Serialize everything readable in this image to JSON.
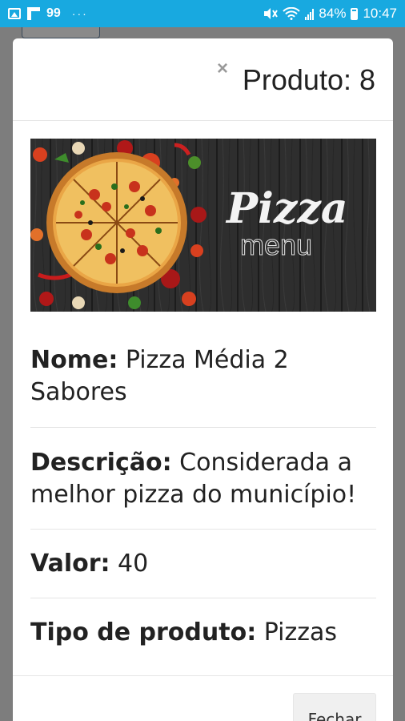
{
  "status_bar": {
    "notification_count": "99",
    "overflow_dots": "···",
    "battery_percent": "84%",
    "time": "10:47"
  },
  "modal": {
    "close_glyph": "×",
    "title": "Produto: 8",
    "banner": {
      "script_text": "Pizza",
      "sub_text": "menu"
    },
    "fields": [
      {
        "label": "Nome:",
        "value": " Pizza Média 2 Sabores"
      },
      {
        "label": "Descrição:",
        "value": " Considerada a melhor pizza do município!"
      },
      {
        "label": "Valor:",
        "value": " 40"
      },
      {
        "label": "Tipo de produto:",
        "value": " Pizzas"
      }
    ],
    "footer_button": "Fechar"
  },
  "colors": {
    "status_bar": "#18a9e0",
    "overlay": "#7a7a7a",
    "banner_wood": "#2b2b2b"
  }
}
